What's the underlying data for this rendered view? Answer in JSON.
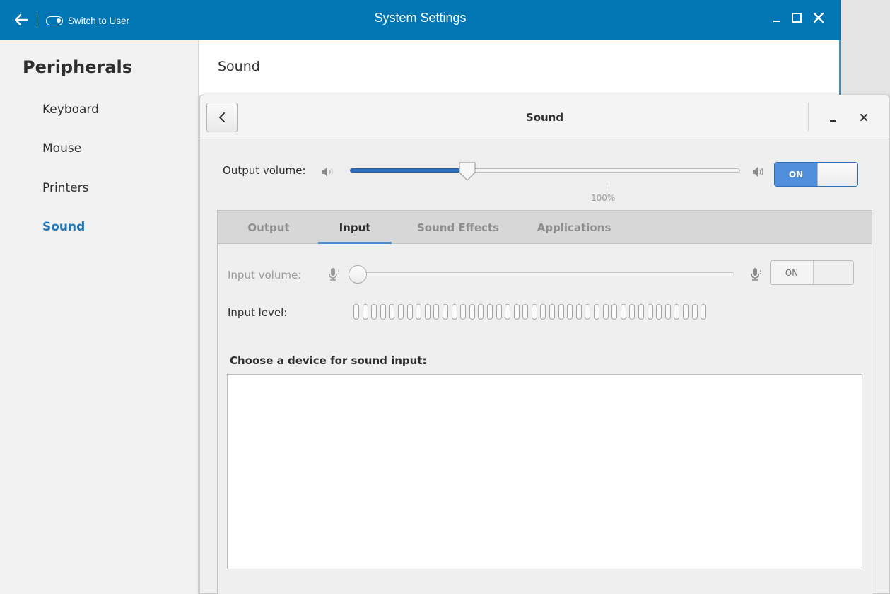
{
  "titlebar": {
    "title": "System Settings",
    "switch_user_label": "Switch to User",
    "icons": {
      "back": "arrow-left-icon",
      "minimize": "minimize-icon",
      "maximize": "maximize-icon",
      "close": "close-icon"
    }
  },
  "sidebar": {
    "heading": "Peripherals",
    "items": [
      {
        "label": "Keyboard",
        "active": false
      },
      {
        "label": "Mouse",
        "active": false
      },
      {
        "label": "Printers",
        "active": false
      },
      {
        "label": "Sound",
        "active": true
      }
    ]
  },
  "content": {
    "title": "Sound"
  },
  "dialog": {
    "title": "Sound",
    "output": {
      "label": "Output volume:",
      "volume_fraction": 0.3,
      "mark_label": "100%",
      "switch_label": "ON",
      "switch_on": true
    },
    "tabs": [
      {
        "label": "Output",
        "active": false
      },
      {
        "label": "Input",
        "active": true
      },
      {
        "label": "Sound Effects",
        "active": false
      },
      {
        "label": "Applications",
        "active": false
      }
    ],
    "input": {
      "volume_label": "Input volume:",
      "volume_fraction": 0.0,
      "switch_label": "ON",
      "level_label": "Input level:",
      "level_segments": 40,
      "level_active_segments": 0,
      "device_label": "Choose a device for sound input:",
      "devices": []
    }
  },
  "colors": {
    "accent": "#0076b4",
    "active_text": "#1f78b9",
    "switch_on": "#4f8fdc",
    "slider_fill": "#2f6fb8"
  }
}
